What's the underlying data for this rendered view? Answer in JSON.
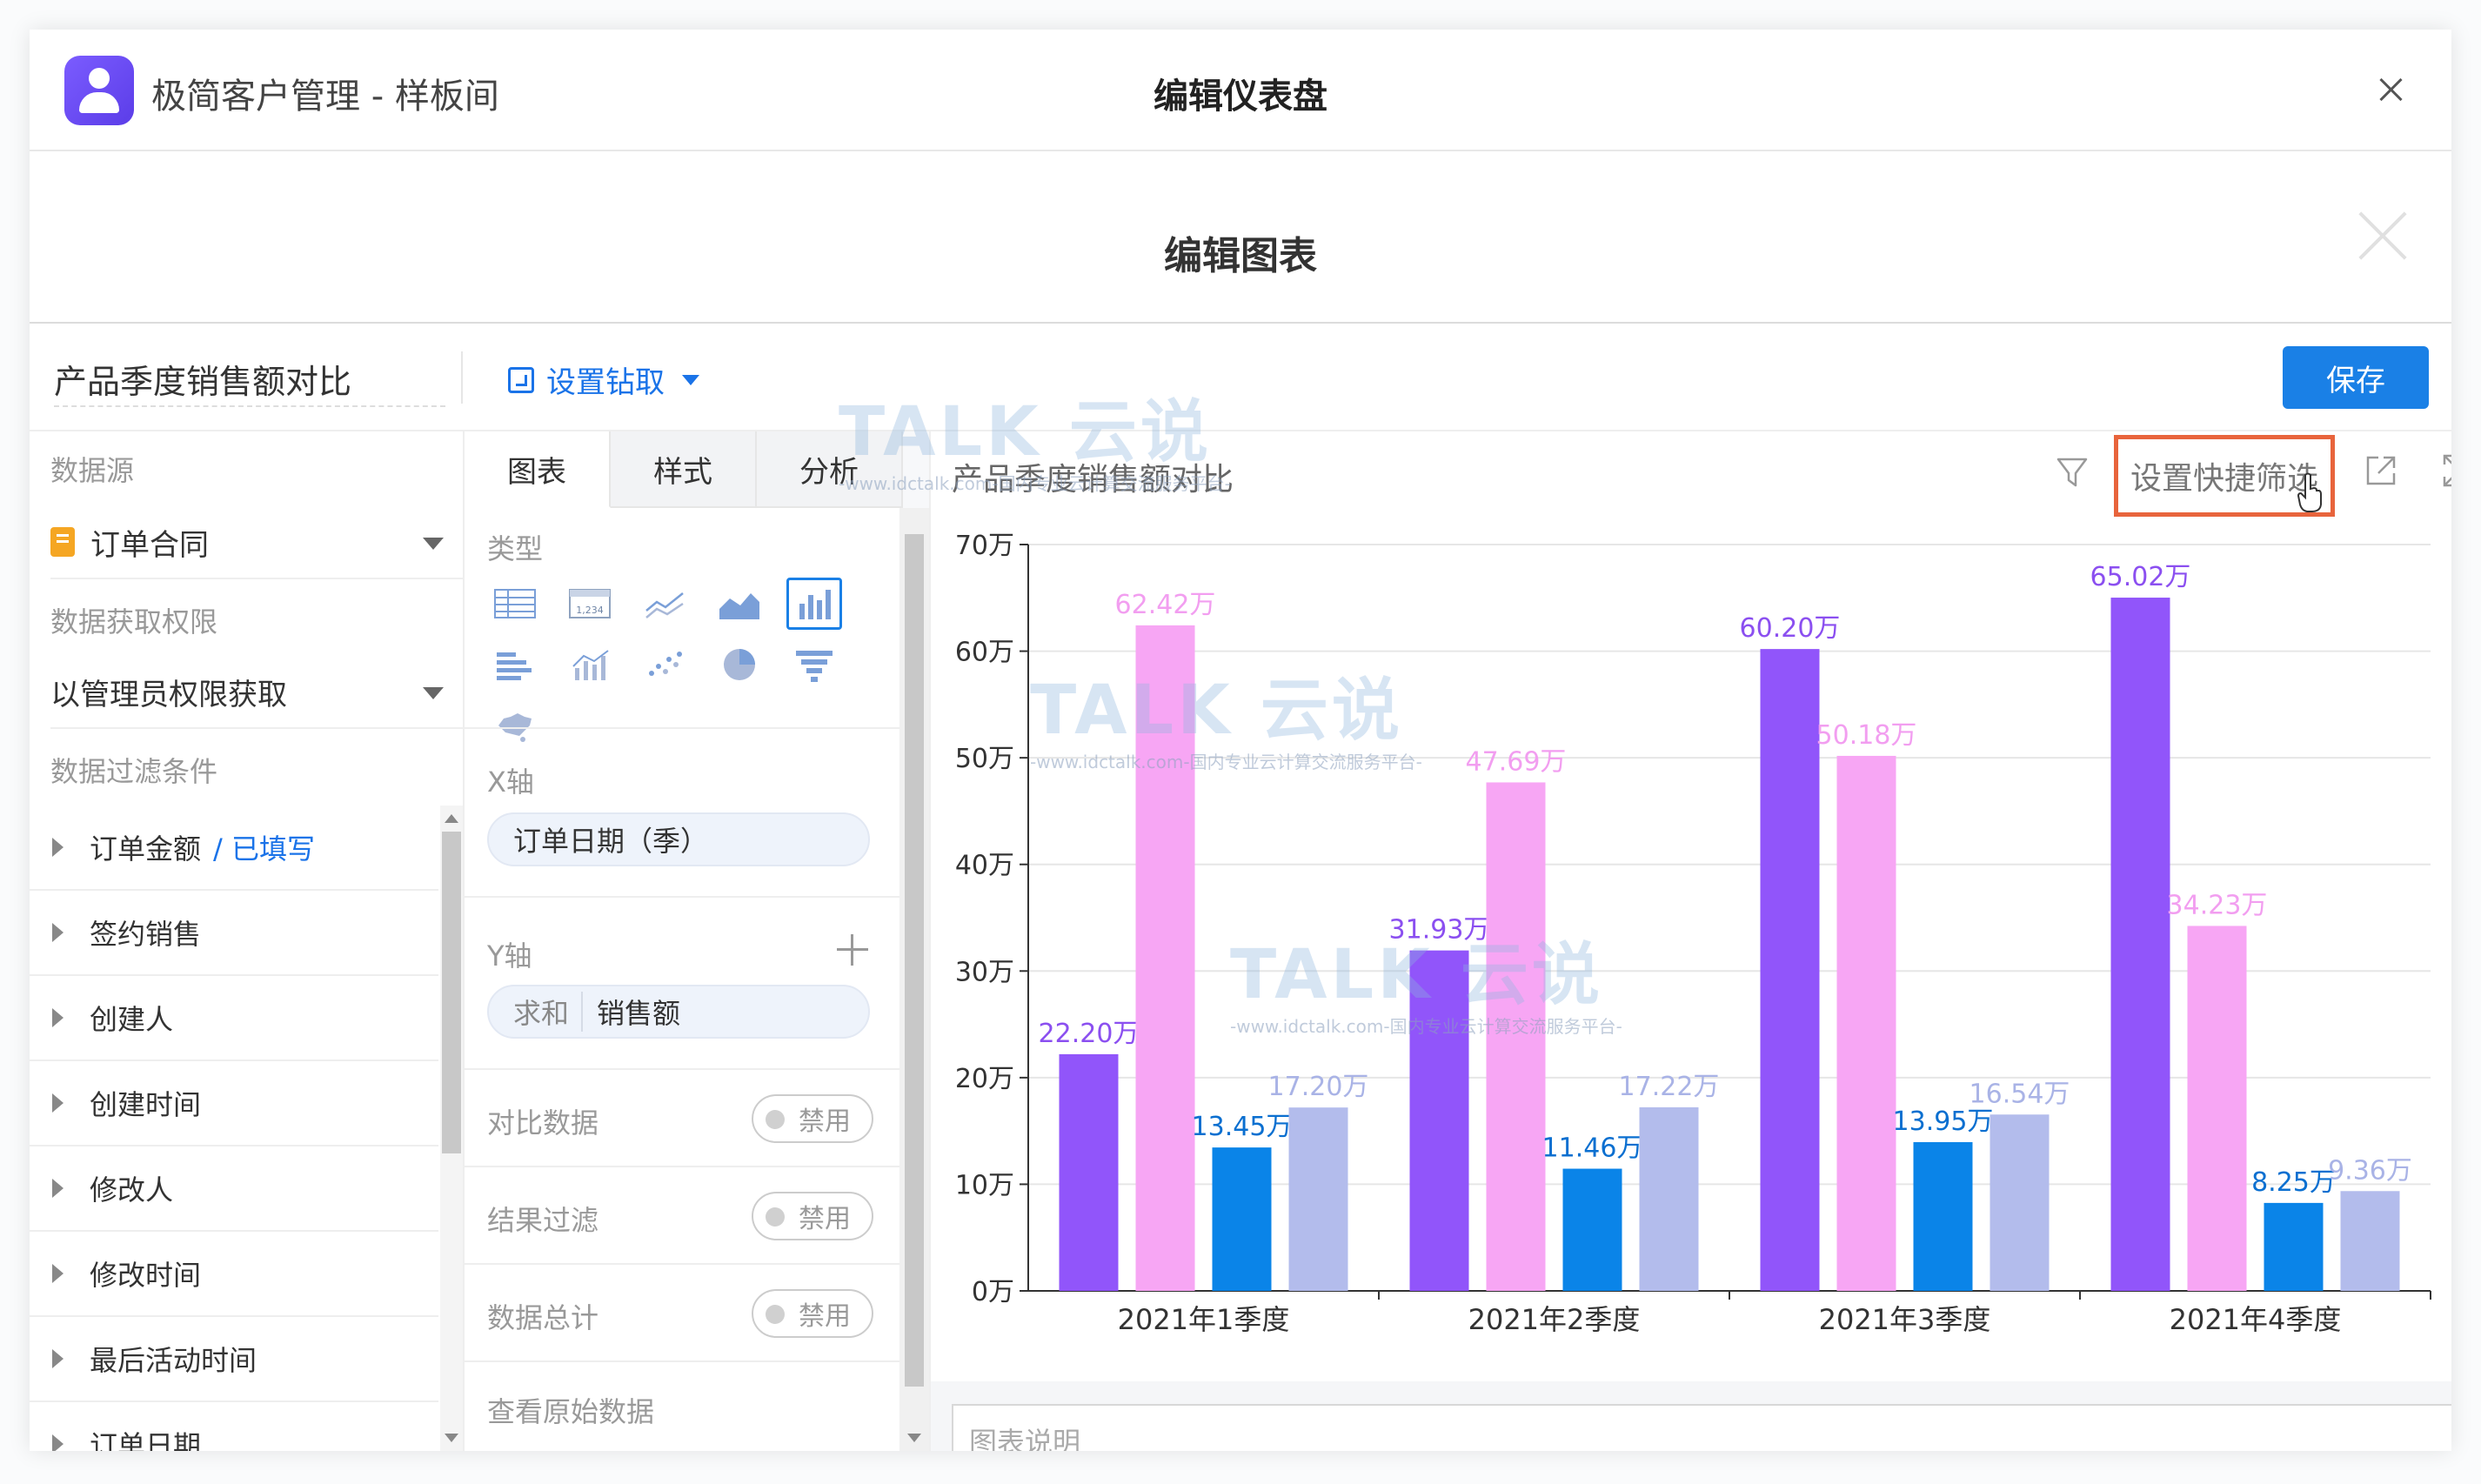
{
  "window": {
    "app_title": "极简客户管理 - 样板间",
    "dialog_title": "编辑仪表盘"
  },
  "subheader": {
    "title": "编辑图表"
  },
  "toolbar": {
    "chart_name": "产品季度销售额对比",
    "drill_label": "设置钻取",
    "save_label": "保存"
  },
  "left": {
    "datasource_label": "数据源",
    "datasource_value": "订单合同",
    "permission_label": "数据获取权限",
    "permission_value": "以管理员权限获取",
    "filter_label": "数据过滤条件",
    "filters": [
      {
        "label": "订单金额",
        "note": "/ 已填写"
      },
      {
        "label": "签约销售",
        "note": ""
      },
      {
        "label": "创建人",
        "note": ""
      },
      {
        "label": "创建时间",
        "note": ""
      },
      {
        "label": "修改人",
        "note": ""
      },
      {
        "label": "修改时间",
        "note": ""
      },
      {
        "label": "最后活动时间",
        "note": ""
      },
      {
        "label": "订单日期",
        "note": ""
      }
    ]
  },
  "middle": {
    "tabs": [
      "图表",
      "样式",
      "分析"
    ],
    "type_label": "类型",
    "chart_types": [
      "table-icon",
      "number-icon",
      "line-chart-icon",
      "area-chart-icon",
      "column-chart-icon",
      "bar-chart-icon",
      "combo-chart-icon",
      "scatter-chart-icon",
      "pie-chart-icon",
      "funnel-chart-icon",
      "map-chart-icon"
    ],
    "xaxis_label": "X轴",
    "xaxis_value": "订单日期（季）",
    "yaxis_label": "Y轴",
    "yaxis_agg": "求和",
    "yaxis_field": "销售额",
    "toggles": [
      {
        "label": "对比数据",
        "state": "禁用"
      },
      {
        "label": "结果过滤",
        "state": "禁用"
      },
      {
        "label": "数据总计",
        "state": "禁用"
      }
    ],
    "raw_data_label": "查看原始数据"
  },
  "chart_panel": {
    "title": "产品季度销售额对比",
    "quick_filter_label": "设置快捷筛选",
    "caption_placeholder": "图表说明"
  },
  "watermark": {
    "brand": "TALK 云说",
    "sub": "-www.idctalk.com-国内专业云计算交流服务平台-"
  },
  "chart_data": {
    "type": "bar",
    "title": "产品季度销售额对比",
    "categories": [
      "2021年1季度",
      "2021年2季度",
      "2021年3季度",
      "2021年4季度"
    ],
    "series": [
      {
        "values": [
          22.2,
          31.93,
          60.2,
          65.02
        ],
        "color": "#9155fa",
        "label_color": "#8b4ff0"
      },
      {
        "values": [
          62.42,
          47.69,
          50.18,
          34.23
        ],
        "color": "#f7a6f4",
        "label_color": "#f29ef0"
      },
      {
        "values": [
          13.45,
          11.46,
          13.95,
          8.25
        ],
        "color": "#0a84e8",
        "label_color": "#0a6fd0"
      },
      {
        "values": [
          17.2,
          17.22,
          16.54,
          9.36
        ],
        "color": "#b3bcec",
        "label_color": "#a9b3e6"
      }
    ],
    "value_suffix": "万",
    "ylim": [
      0,
      70
    ],
    "yticks": [
      "0万",
      "10万",
      "20万",
      "30万",
      "40万",
      "50万",
      "60万",
      "70万"
    ],
    "grid": true
  }
}
